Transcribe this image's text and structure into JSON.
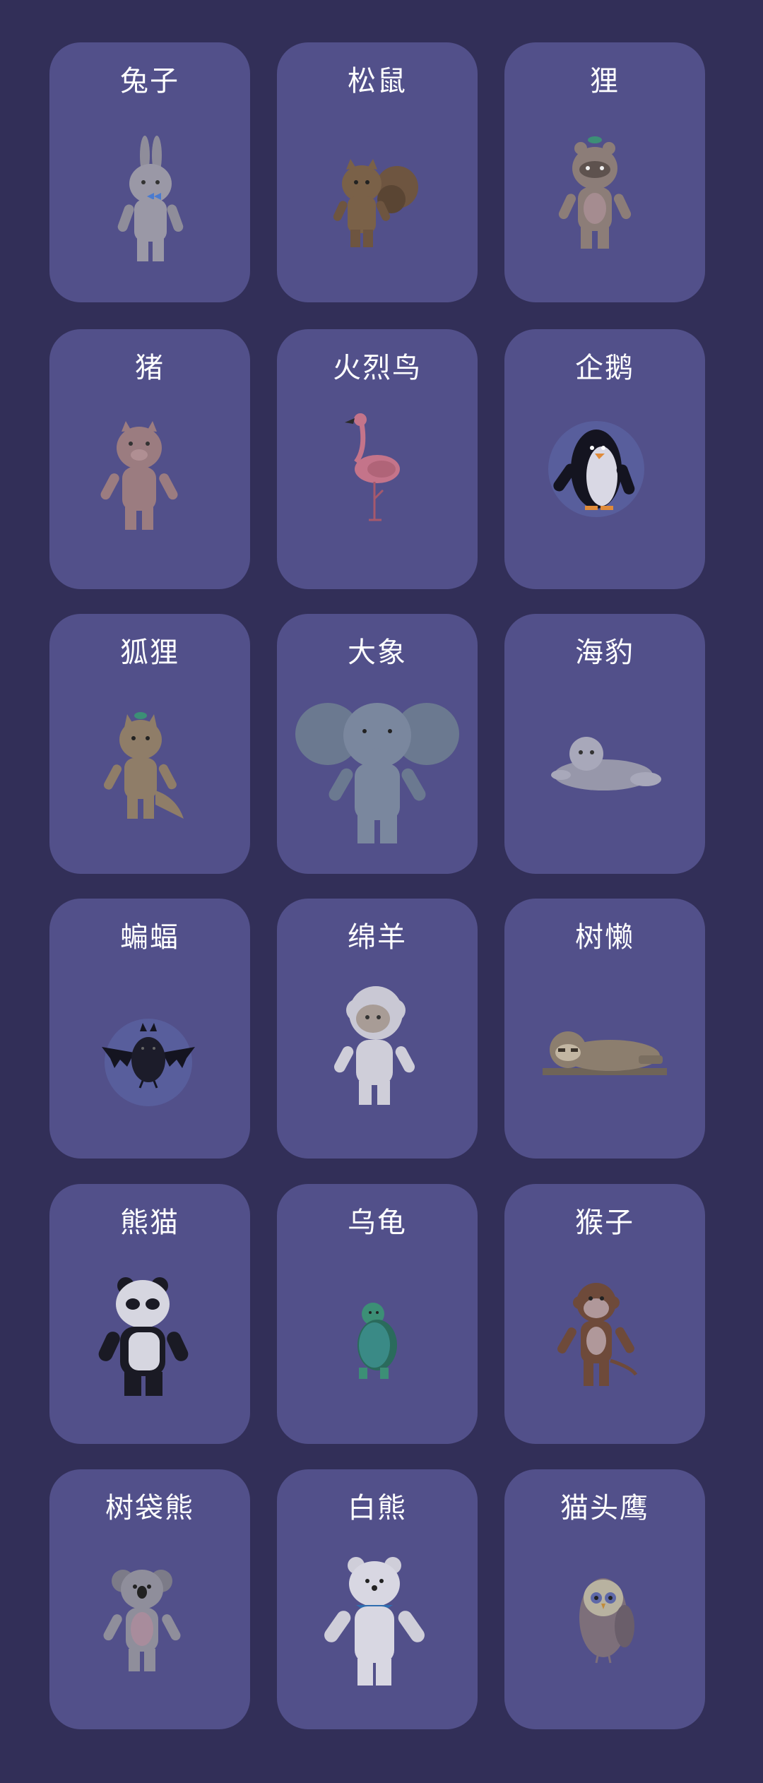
{
  "animals": [
    {
      "name": "兔子",
      "icon": "rabbit-icon"
    },
    {
      "name": "松鼠",
      "icon": "squirrel-icon"
    },
    {
      "name": "狸",
      "icon": "raccoon-dog-icon"
    },
    {
      "name": "猪",
      "icon": "pig-icon"
    },
    {
      "name": "火烈鸟",
      "icon": "flamingo-icon"
    },
    {
      "name": "企鹅",
      "icon": "penguin-icon"
    },
    {
      "name": "狐狸",
      "icon": "fox-icon"
    },
    {
      "name": "大象",
      "icon": "elephant-icon"
    },
    {
      "name": "海豹",
      "icon": "seal-icon"
    },
    {
      "name": "蝙蝠",
      "icon": "bat-icon"
    },
    {
      "name": "绵羊",
      "icon": "sheep-icon"
    },
    {
      "name": "树懒",
      "icon": "sloth-icon"
    },
    {
      "name": "熊猫",
      "icon": "panda-icon"
    },
    {
      "name": "乌龟",
      "icon": "turtle-icon"
    },
    {
      "name": "猴子",
      "icon": "monkey-icon"
    },
    {
      "name": "树袋熊",
      "icon": "koala-icon"
    },
    {
      "name": "白熊",
      "icon": "polar-bear-icon"
    },
    {
      "name": "猫头鹰",
      "icon": "owl-icon"
    }
  ],
  "colors": {
    "background": "#322f58",
    "card": "#52508a",
    "title": "#ffffff"
  }
}
